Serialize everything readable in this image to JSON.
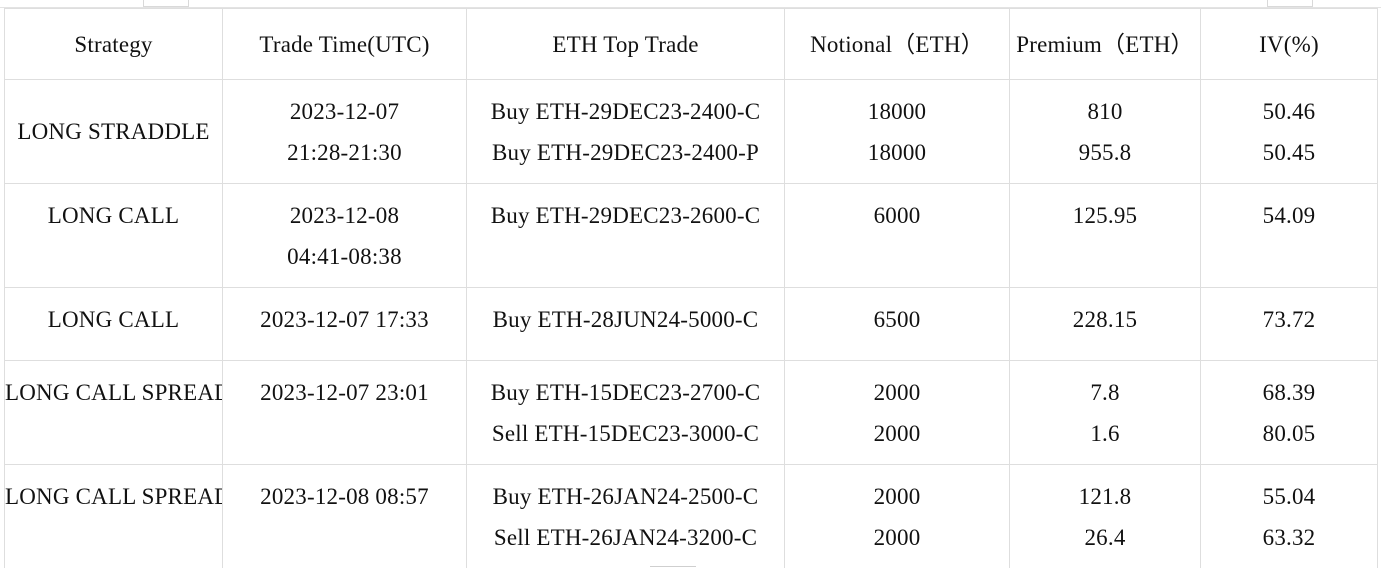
{
  "table": {
    "headers": {
      "strategy": "Strategy",
      "trade_time": "Trade Time(UTC)",
      "top_trade": "ETH Top Trade",
      "notional": "Notional（ETH）",
      "premium": "Premium（ETH）",
      "iv": "IV(%)"
    },
    "rows": [
      {
        "strategy": "LONG STRADDLE",
        "time_line1": "2023-12-07",
        "time_line2": "21:28-21:30",
        "legs": [
          {
            "trade": "Buy ETH-29DEC23-2400-C",
            "notional": "18000",
            "premium": "810",
            "iv": "50.46"
          },
          {
            "trade": "Buy ETH-29DEC23-2400-P",
            "notional": "18000",
            "premium": "955.8",
            "iv": "50.45"
          }
        ]
      },
      {
        "strategy": "LONG CALL",
        "time_line1": "2023-12-08",
        "time_line2": "04:41-08:38",
        "legs": [
          {
            "trade": "Buy ETH-29DEC23-2600-C",
            "notional": "6000",
            "premium": "125.95",
            "iv": "54.09"
          }
        ]
      },
      {
        "strategy": "LONG CALL",
        "time_line1": "2023-12-07 17:33",
        "legs": [
          {
            "trade": "Buy ETH-28JUN24-5000-C",
            "notional": "6500",
            "premium": "228.15",
            "iv": "73.72"
          }
        ]
      },
      {
        "strategy": "LONG CALL SPREAD",
        "time_line1": "2023-12-07 23:01",
        "legs": [
          {
            "trade": "Buy ETH-15DEC23-2700-C",
            "notional": "2000",
            "premium": "7.8",
            "iv": "68.39"
          },
          {
            "trade": "Sell ETH-15DEC23-3000-C",
            "notional": "2000",
            "premium": "1.6",
            "iv": "80.05"
          }
        ]
      },
      {
        "strategy": "LONG CALL SPREAD",
        "time_line1": "2023-12-08 08:57",
        "legs": [
          {
            "trade": "Buy ETH-26JAN24-2500-C",
            "notional": "2000",
            "premium": "121.8",
            "iv": "55.04"
          },
          {
            "trade": "Sell ETH-26JAN24-3200-C",
            "notional": "2000",
            "premium": "26.4",
            "iv": "63.32"
          }
        ]
      }
    ]
  }
}
